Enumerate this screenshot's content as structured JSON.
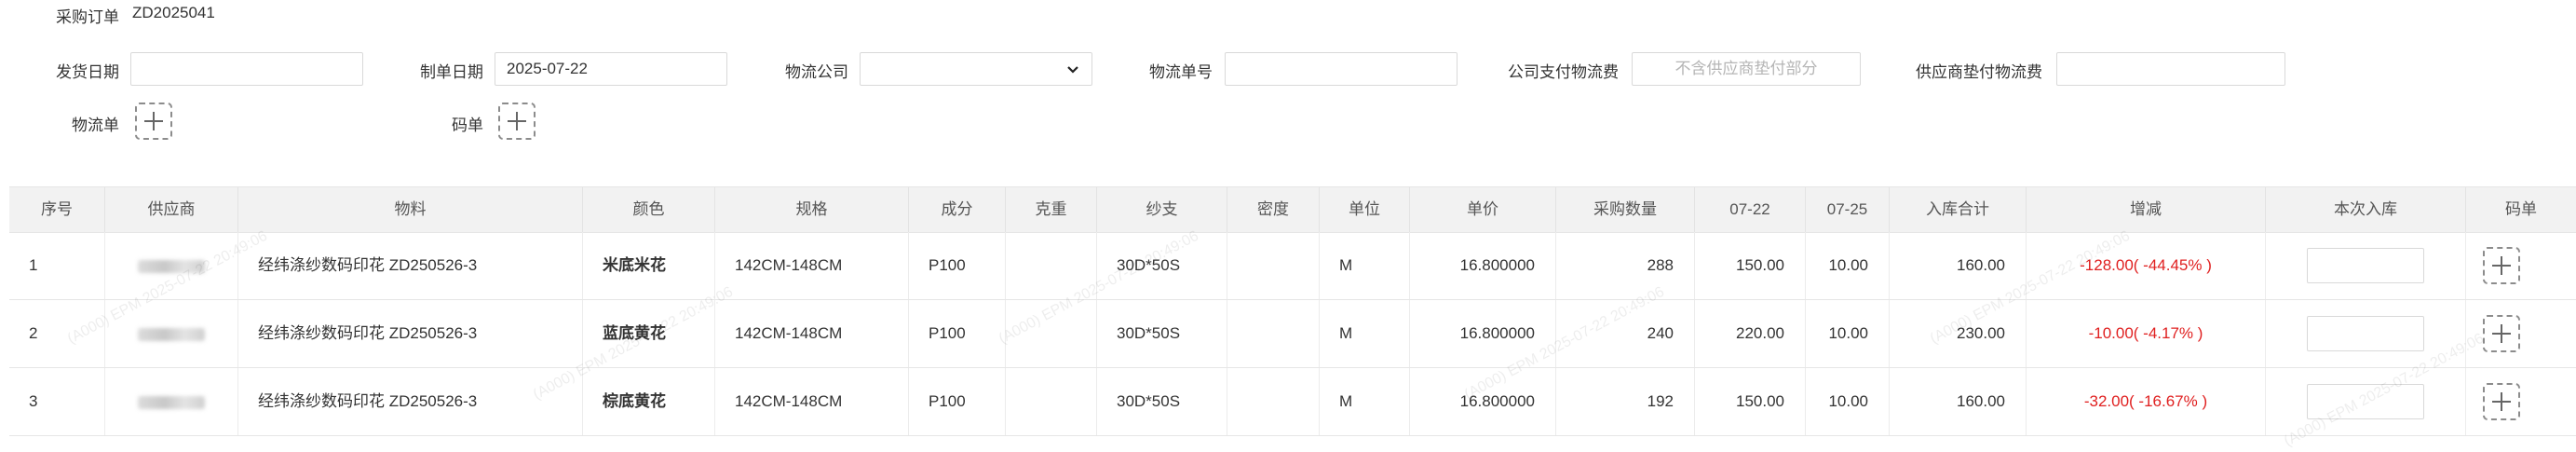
{
  "header": {
    "order_label": "采购订单",
    "order_no": "ZD2025041"
  },
  "form": {
    "ship_date_label": "发货日期",
    "ship_date_value": "",
    "made_date_label": "制单日期",
    "made_date_value": "2025-07-22",
    "logistics_company_label": "物流公司",
    "logistics_company_value": "",
    "logistics_no_label": "物流单号",
    "logistics_no_value": "",
    "company_fee_label": "公司支付物流费",
    "company_fee_placeholder": "不含供应商垫付部分",
    "supplier_fee_label": "供应商垫付物流费",
    "supplier_fee_value": "",
    "logistics_doc_label": "物流单",
    "code_doc_label": "码单"
  },
  "table": {
    "headers": [
      "序号",
      "供应商",
      "物料",
      "颜色",
      "规格",
      "成分",
      "克重",
      "纱支",
      "密度",
      "单位",
      "单价",
      "采购数量",
      "07-22",
      "07-25",
      "入库合计",
      "增减",
      "本次入库",
      "码单"
    ],
    "rows": [
      {
        "no": "1",
        "supplier": "",
        "material": "经纬涤纱数码印花 ZD250526-3",
        "color": "米底米花",
        "spec": "142CM-148CM",
        "comp": "P100",
        "weight": "",
        "yarn": "30D*50S",
        "density": "",
        "unit": "M",
        "price": "16.800000",
        "qty": "288",
        "d0722": "150.00",
        "d0725": "10.00",
        "total": "160.00",
        "diff": "-128.00( -44.45% )",
        "this_in": ""
      },
      {
        "no": "2",
        "supplier": "",
        "material": "经纬涤纱数码印花 ZD250526-3",
        "color": "蓝底黄花",
        "spec": "142CM-148CM",
        "comp": "P100",
        "weight": "",
        "yarn": "30D*50S",
        "density": "",
        "unit": "M",
        "price": "16.800000",
        "qty": "240",
        "d0722": "220.00",
        "d0725": "10.00",
        "total": "230.00",
        "diff": "-10.00( -4.17% )",
        "this_in": ""
      },
      {
        "no": "3",
        "supplier": "",
        "material": "经纬涤纱数码印花 ZD250526-3",
        "color": "棕底黄花",
        "spec": "142CM-148CM",
        "comp": "P100",
        "weight": "",
        "yarn": "30D*50S",
        "density": "",
        "unit": "M",
        "price": "16.800000",
        "qty": "192",
        "d0722": "150.00",
        "d0725": "10.00",
        "total": "160.00",
        "diff": "-32.00( -16.67% )",
        "this_in": ""
      }
    ]
  },
  "watermark": "(A000) EPM 2025-07-22 20:49:06",
  "colors": {
    "negative": "#e02020",
    "header_bg": "#f2f2f2"
  },
  "icons": {
    "add": "plus-icon",
    "dropdown": "chevron-down-icon"
  }
}
